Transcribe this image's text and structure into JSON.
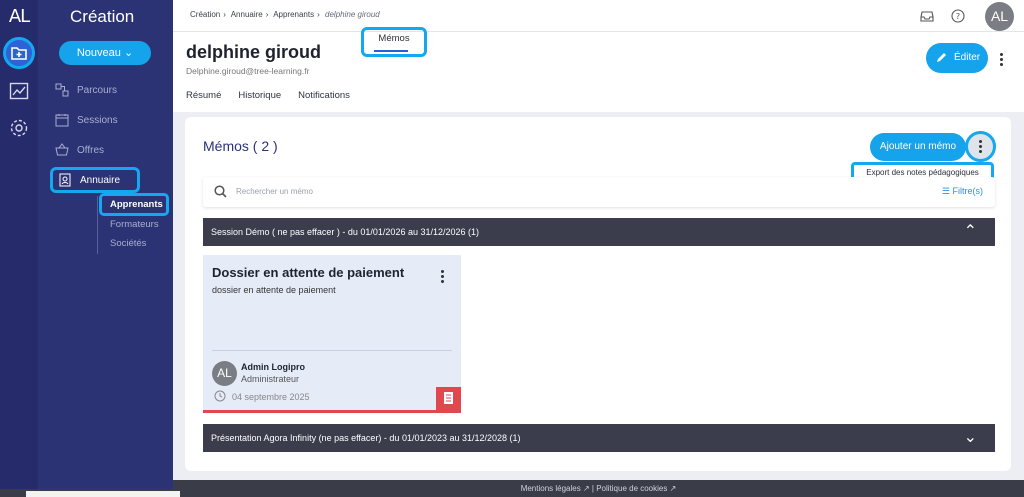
{
  "rail": {
    "logo": "AL"
  },
  "sidebar": {
    "title": "Création",
    "new_button": "Nouveau",
    "items": [
      {
        "label": "Parcours"
      },
      {
        "label": "Sessions"
      },
      {
        "label": "Offres"
      },
      {
        "label": "Annuaire"
      }
    ],
    "sub_items": [
      {
        "label": "Apprenants"
      },
      {
        "label": "Formateurs"
      },
      {
        "label": "Sociétés"
      }
    ]
  },
  "breadcrumb": {
    "items": [
      "Création",
      "Annuaire",
      "Apprenants"
    ],
    "current": "delphine giroud"
  },
  "user": {
    "initials": "AL"
  },
  "profile": {
    "name": "delphine giroud",
    "email": "Delphine.giroud@tree-learning.fr",
    "edit_label": "Éditer"
  },
  "tabs": [
    {
      "label": "Résumé"
    },
    {
      "label": "Historique"
    },
    {
      "label": "Notifications"
    },
    {
      "label": "Mémos"
    }
  ],
  "memos": {
    "heading": "Mémos ( 2 )",
    "add_button": "Ajouter un mémo",
    "menu_item": "Export des notes pédagogiques",
    "search_placeholder": "Rechercher un mémo",
    "filter_label": "Filtre(s)",
    "groups": [
      {
        "label": "Session Démo ( ne pas effacer ) - du 01/01/2026 au 31/12/2026 (1)"
      },
      {
        "label": "Présentation Agora Infinity (ne pas effacer) - du 01/01/2023 au 31/12/2028 (1)"
      }
    ],
    "card": {
      "title": "Dossier en attente de paiement",
      "body": "dossier en attente de paiement",
      "author_initials": "AL",
      "author": "Admin Logipro",
      "role": "Administrateur",
      "date": "04 septembre 2025"
    }
  },
  "footer": {
    "legal": "Mentions légales",
    "privacy": "Politique de cookies"
  }
}
